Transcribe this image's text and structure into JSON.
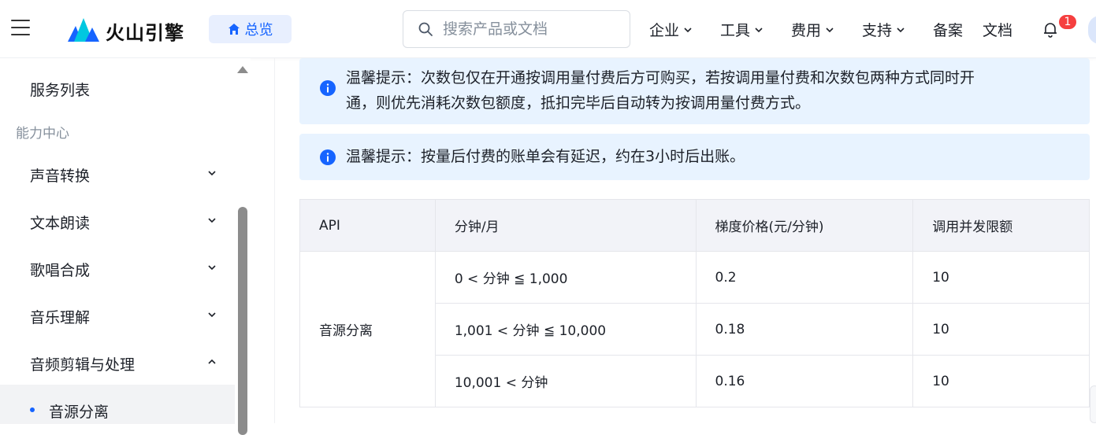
{
  "header": {
    "logo_text": "火山引擎",
    "overview_label": "总览",
    "search_placeholder": "搜索产品或文档",
    "nav": [
      {
        "label": "企业",
        "has_dropdown": true
      },
      {
        "label": "工具",
        "has_dropdown": true
      },
      {
        "label": "费用",
        "has_dropdown": true
      },
      {
        "label": "支持",
        "has_dropdown": true
      },
      {
        "label": "备案",
        "has_dropdown": false
      },
      {
        "label": "文档",
        "has_dropdown": false
      }
    ],
    "notification_count": "1"
  },
  "sidebar": {
    "service_list": "服务列表",
    "group_label": "能力中心",
    "items": [
      {
        "label": "声音转换",
        "expanded": false
      },
      {
        "label": "文本朗读",
        "expanded": false
      },
      {
        "label": "歌唱合成",
        "expanded": false
      },
      {
        "label": "音乐理解",
        "expanded": false
      },
      {
        "label": "音频剪辑与处理",
        "expanded": true
      }
    ],
    "active_sub_item": "音源分离"
  },
  "notices": [
    {
      "line1": "温馨提示：次数包仅在开通按调用量付费后方可购买，若按调用量付费和次数包两种方式同时开",
      "line2": "通，则优先消耗次数包额度，抵扣完毕后自动转为按调用量付费方式。"
    },
    {
      "line1": "温馨提示：按量后付费的账单会有延迟，约在3小时后出账。"
    }
  ],
  "table": {
    "headers": [
      "API",
      "分钟/月",
      "梯度价格(元/分钟)",
      "调用并发限额"
    ],
    "api_name": "音源分离",
    "rows": [
      {
        "range": "0 < 分钟 ≦ 1,000",
        "price": "0.2",
        "limit": "10"
      },
      {
        "range": "1,001 < 分钟 ≦ 10,000",
        "price": "0.18",
        "limit": "10"
      },
      {
        "range": "10,001 < 分钟",
        "price": "0.16",
        "limit": "10"
      }
    ]
  },
  "colors": {
    "accent": "#1664ff",
    "notice_bg": "#e8f3ff",
    "badge": "#f53f3f"
  }
}
